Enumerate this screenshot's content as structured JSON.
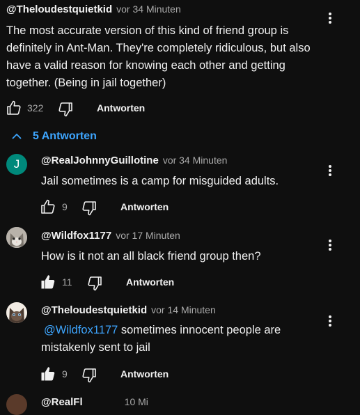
{
  "top_comment": {
    "author": "@Theloudestquietkid",
    "time": "vor 34 Minuten",
    "text": "The most accurate version of this kind of friend group is definitely in Ant-Man. They're completely ridiculous, but also have a valid reason for knowing each other and getting together. (Being in jail together)",
    "likes": "322",
    "reply_label": "Antworten"
  },
  "replies_toggle": {
    "label": "5 Antworten",
    "icon": "chevron-up-icon",
    "color": "#3ea6ff"
  },
  "replies": [
    {
      "author": "@RealJohnnyGuillotine",
      "time": "vor 34 Minuten",
      "avatar_letter": "J",
      "avatar_color": "#00897b",
      "text": "Jail sometimes is a camp for misguided adults.",
      "likes": "9",
      "liked": false,
      "reply_label": "Antworten"
    },
    {
      "author": "@Wildfox1177",
      "time": "vor 17 Minuten",
      "avatar_icon": "cat-avatar",
      "text": "How is it not an all black friend group then?",
      "likes": "11",
      "liked": true,
      "reply_label": "Antworten"
    },
    {
      "author": "@Theloudestquietkid",
      "time": "vor 14 Minuten",
      "avatar_icon": "cat-avatar",
      "mention": "@Wildfox1177",
      "text": "sometimes innocent people are mistakenly sent to jail",
      "likes": "9",
      "liked": true,
      "reply_label": "Antworten"
    }
  ],
  "cut_off_author": "@RealFl",
  "cut_off_time": "10 Mi"
}
